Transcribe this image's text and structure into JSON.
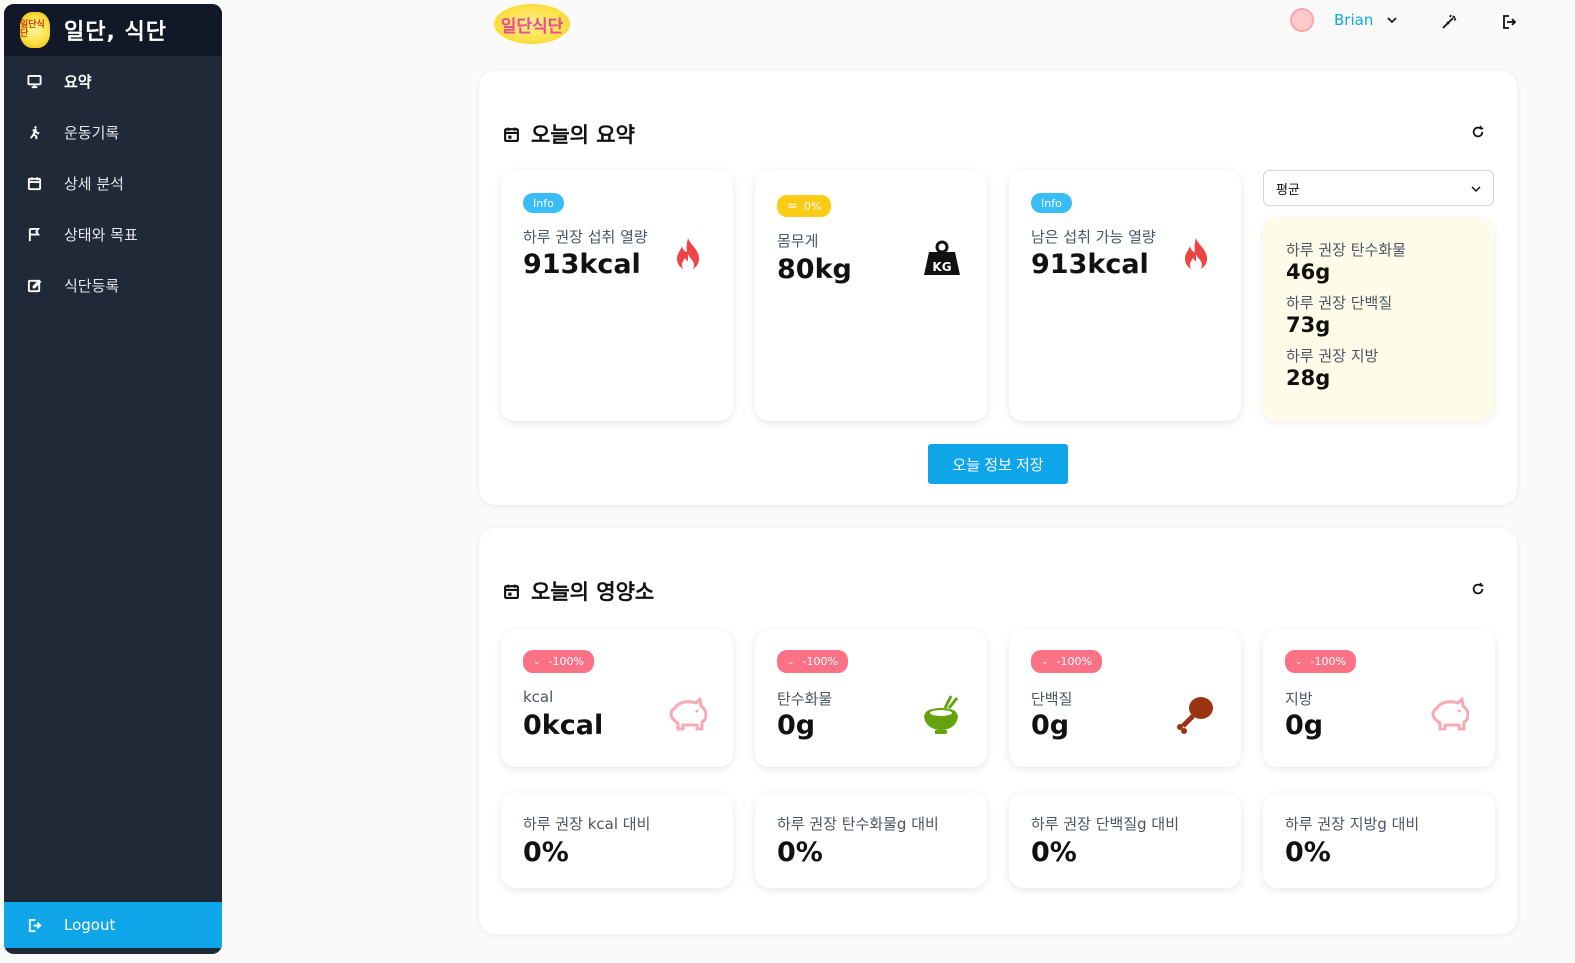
{
  "app": {
    "title": "일단, 식단",
    "logo_text": "일단식단",
    "logo_mini_text": "일단식단"
  },
  "sidebar": {
    "items": [
      {
        "label": "요약",
        "icon": "monitor-icon",
        "active": true
      },
      {
        "label": "운동기록",
        "icon": "running-icon",
        "active": false
      },
      {
        "label": "상세 분석",
        "icon": "calendar-icon",
        "active": false
      },
      {
        "label": "상태와 목표",
        "icon": "flag-icon",
        "active": false
      },
      {
        "label": "식단등록",
        "icon": "edit-icon",
        "active": false
      }
    ],
    "logout_label": "Logout"
  },
  "header": {
    "username": "Brian",
    "icons": [
      "avatar",
      "chevron-down-icon",
      "magic-wand-icon",
      "logout-icon"
    ]
  },
  "summary": {
    "title": "오늘의 요약",
    "cards": [
      {
        "badge": "Info",
        "label": "하루 권장 섭취 열량",
        "value": "913kcal",
        "icon": "fire-icon"
      },
      {
        "badge": "0%",
        "label": "몸무게",
        "value": "80kg",
        "icon": "weight-icon"
      },
      {
        "badge": "Info",
        "label": "남은 섭취 가능 열량",
        "value": "913kcal",
        "icon": "fire-icon"
      }
    ],
    "select_value": "평균",
    "macros": [
      {
        "label": "하루 권장 탄수화물",
        "value": "46g"
      },
      {
        "label": "하루 권장 단백질",
        "value": "73g"
      },
      {
        "label": "하루 권장 지방",
        "value": "28g"
      }
    ],
    "save_button": "오늘 정보 저장"
  },
  "nutrients": {
    "title": "오늘의 영양소",
    "cards": [
      {
        "badge": "-100%",
        "label": "kcal",
        "value": "0kcal",
        "icon": "pig-icon"
      },
      {
        "badge": "-100%",
        "label": "탄수화물",
        "value": "0g",
        "icon": "rice-bowl-icon"
      },
      {
        "badge": "-100%",
        "label": "단백질",
        "value": "0g",
        "icon": "chicken-leg-icon"
      },
      {
        "badge": "-100%",
        "label": "지방",
        "value": "0g",
        "icon": "pig-icon"
      }
    ],
    "ratios": [
      {
        "label": "하루 권장 kcal 대비",
        "value": "0%"
      },
      {
        "label": "하루 권장 탄수화물g 대비",
        "value": "0%"
      },
      {
        "label": "하루 권장 단백질g 대비",
        "value": "0%"
      },
      {
        "label": "하루 권장 지방g 대비",
        "value": "0%"
      }
    ]
  },
  "colors": {
    "sidebar_bg": "#1f2937",
    "accent": "#0ea5e9",
    "info_badge": "#38bdf8",
    "warn_badge": "#facc15",
    "neg_badge": "#fb7185",
    "fire": "#ef4444",
    "pig": "#f9a8b4",
    "bowl": "#65a30d",
    "chicken": "#9a3412"
  }
}
